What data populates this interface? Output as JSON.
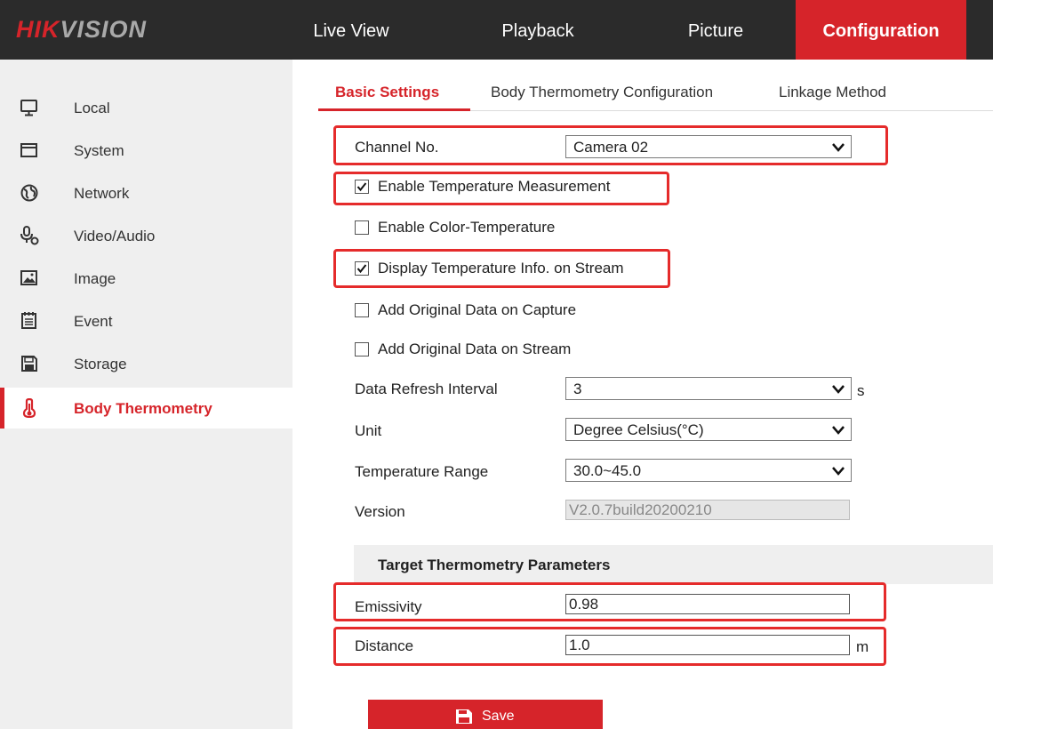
{
  "brand": {
    "part1": "HIK",
    "part2": "VISION"
  },
  "nav": {
    "items": [
      {
        "label": "Live View"
      },
      {
        "label": "Playback"
      },
      {
        "label": "Picture"
      },
      {
        "label": "Configuration"
      }
    ],
    "active": "Configuration"
  },
  "sidebar": {
    "items": [
      {
        "label": "Local",
        "icon": "monitor-icon"
      },
      {
        "label": "System",
        "icon": "window-icon"
      },
      {
        "label": "Network",
        "icon": "globe-icon"
      },
      {
        "label": "Video/Audio",
        "icon": "microphone-camera-icon"
      },
      {
        "label": "Image",
        "icon": "image-icon"
      },
      {
        "label": "Event",
        "icon": "calendar-icon"
      },
      {
        "label": "Storage",
        "icon": "floppy-disk-icon"
      },
      {
        "label": "Body Thermometry",
        "icon": "thermometer-icon"
      }
    ],
    "active": "Body Thermometry"
  },
  "tabs": {
    "items": [
      {
        "label": "Basic Settings"
      },
      {
        "label": "Body Thermometry Configuration"
      },
      {
        "label": "Linkage Method"
      }
    ],
    "active": "Basic Settings"
  },
  "form": {
    "channel": {
      "label": "Channel No.",
      "value": "Camera 02"
    },
    "checkboxes": [
      {
        "label": "Enable Temperature Measurement",
        "checked": true
      },
      {
        "label": "Enable Color-Temperature",
        "checked": false
      },
      {
        "label": "Display Temperature Info. on Stream",
        "checked": true
      },
      {
        "label": "Add Original Data on Capture",
        "checked": false
      },
      {
        "label": "Add Original Data on Stream",
        "checked": false
      }
    ],
    "refresh": {
      "label": "Data Refresh Interval",
      "value": "3",
      "unit": "s"
    },
    "unit": {
      "label": "Unit",
      "value": "Degree Celsius(°C)"
    },
    "range": {
      "label": "Temperature Range",
      "value": "30.0~45.0"
    },
    "version": {
      "label": "Version",
      "value": "V2.0.7build20200210"
    }
  },
  "target": {
    "title": "Target Thermometry Parameters",
    "emissivity": {
      "label": "Emissivity",
      "value": "0.98"
    },
    "distance": {
      "label": "Distance",
      "value": "1.0",
      "unit": "m"
    }
  },
  "save": {
    "label": "Save"
  },
  "colors": {
    "accent": "#d6242a",
    "topbar": "#2b2b2b",
    "highlight": "#e52b2b",
    "sidebar": "#efefef"
  }
}
